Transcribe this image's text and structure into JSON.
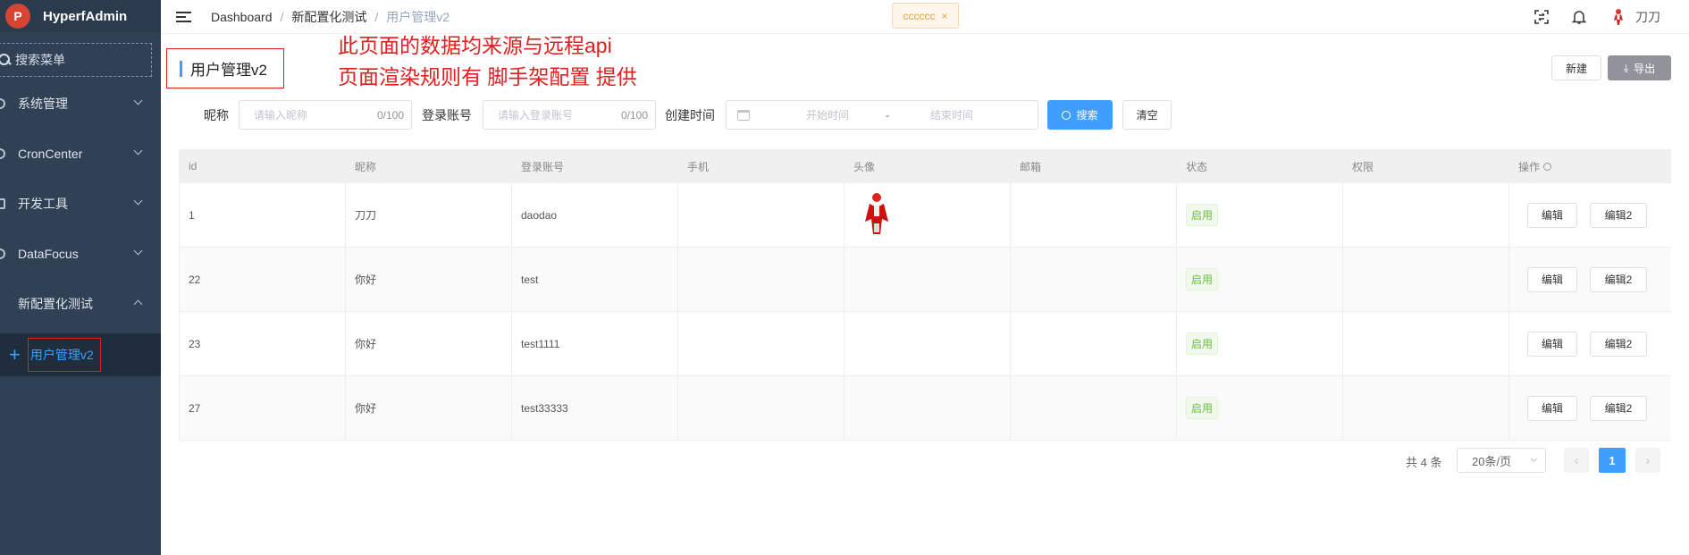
{
  "app": {
    "name": "HyperfAdmin",
    "logo_letter": "P"
  },
  "sidebar": {
    "search_label": "搜索菜单",
    "items": [
      {
        "label": "系统管理"
      },
      {
        "label": "CronCenter"
      },
      {
        "label": "开发工具"
      },
      {
        "label": "DataFocus"
      },
      {
        "label": "新配置化测试"
      }
    ],
    "active_sub": {
      "label": "用户管理v2"
    }
  },
  "topbar": {
    "breadcrumb": [
      "Dashboard",
      "新配置化测试",
      "用户管理v2"
    ],
    "tag": {
      "label": "cccccc",
      "close": "×"
    },
    "username": "刀刀"
  },
  "page": {
    "title": "用户管理v2",
    "annotation_line1": "此页面的数据均来源与远程api",
    "annotation_line2": "页面渲染规则有 脚手架配置 提供",
    "new_label": "新建",
    "export_label": "导出",
    "export_icon": "download-icon"
  },
  "filters": {
    "nickname_label": "昵称",
    "nickname_placeholder": "请输入昵称",
    "nickname_count": "0/100",
    "account_label": "登录账号",
    "account_placeholder": "请输入登录账号",
    "account_count": "0/100",
    "created_label": "创建时间",
    "start_placeholder": "开始时间",
    "range_sep": "-",
    "end_placeholder": "结束时间",
    "search_label": "搜索",
    "clear_label": "清空"
  },
  "table": {
    "columns": [
      "id",
      "昵称",
      "登录账号",
      "手机",
      "头像",
      "邮箱",
      "状态",
      "权限",
      "操作"
    ],
    "rows": [
      {
        "id": "1",
        "nickname": "刀刀",
        "account": "daodao",
        "phone": "",
        "has_avatar": true,
        "email": "",
        "status": "启用",
        "perm": ""
      },
      {
        "id": "22",
        "nickname": "你好",
        "account": "test",
        "phone": "",
        "has_avatar": false,
        "email": "",
        "status": "启用",
        "perm": ""
      },
      {
        "id": "23",
        "nickname": "你好",
        "account": "test1111",
        "phone": "",
        "has_avatar": false,
        "email": "",
        "status": "启用",
        "perm": ""
      },
      {
        "id": "27",
        "nickname": "你好",
        "account": "test33333",
        "phone": "",
        "has_avatar": false,
        "email": "",
        "status": "启用",
        "perm": ""
      }
    ],
    "edit_label": "编辑",
    "edit2_label": "编辑2"
  },
  "pagination": {
    "total": "共 4 条",
    "page_size": "20条/页",
    "current_page": "1",
    "prev": "‹",
    "next": "›"
  },
  "colors": {
    "sidebar_bg": "#304156",
    "accent": "#409eff",
    "annotation_red": "#e02020",
    "success": "#67c23a"
  }
}
